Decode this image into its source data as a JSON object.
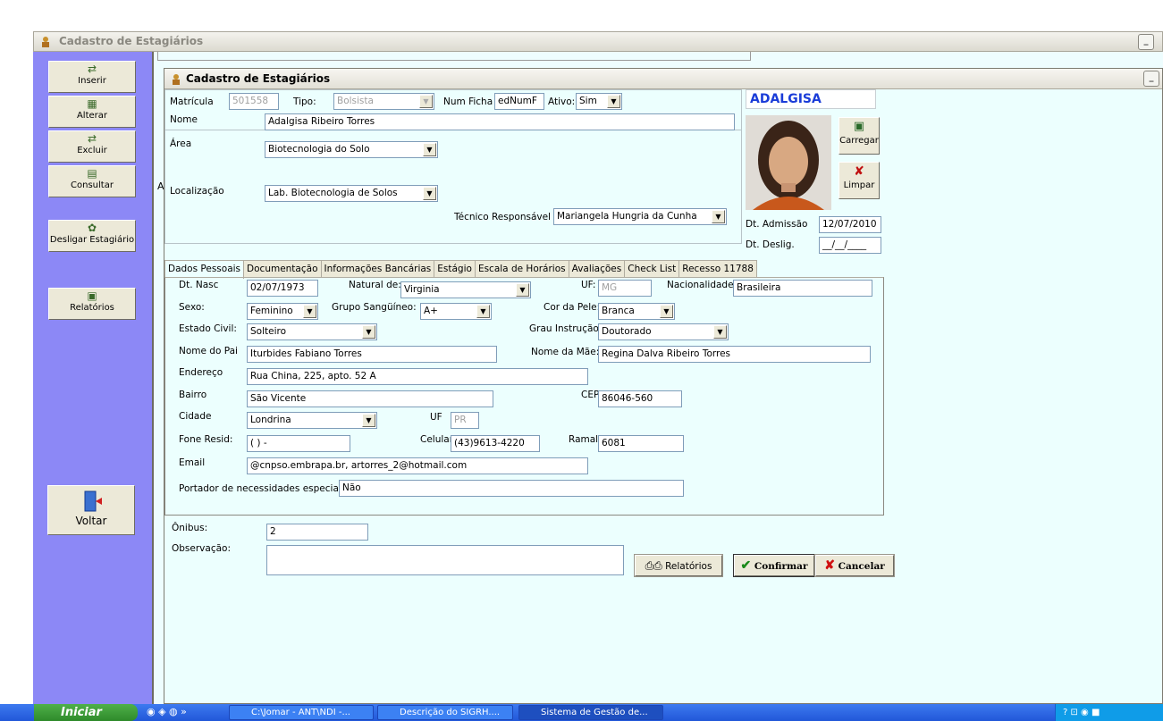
{
  "outer_window": {
    "title": "Cadastro de Estagiários"
  },
  "toolbar": {
    "insert_label": "Inserir",
    "alter_label": "Alterar",
    "delete_label": "Excluir",
    "query_label": "Consultar",
    "disconnect_label": "Desligar Estagiário",
    "reports_label": "Relatórios",
    "back_label": "Voltar"
  },
  "background_window": {
    "label_a": "A"
  },
  "inner_window": {
    "title": "Cadastro de Estagiários"
  },
  "header": {
    "matricula_label": "Matrícula",
    "matricula_value": "501558",
    "tipo_label": "Tipo:",
    "tipo_value": "Bolsista",
    "num_ficha_label": "Num Ficha",
    "num_ficha_value": "edNumF",
    "ativo_label": "Ativo:",
    "ativo_value": "Sim",
    "nome_label": "Nome",
    "nome_value": "Adalgisa Ribeiro Torres",
    "area_label": "Área",
    "area_value": "Biotecnologia do Solo",
    "localizacao_label": "Localização",
    "localizacao_value": "Lab. Biotecnologia de Solos",
    "tecnico_label": "Técnico Responsável",
    "tecnico_value": "Mariangela Hungria da Cunha"
  },
  "photo_panel": {
    "name_badge": "ADALGISA",
    "load_label": "Carregar",
    "clear_label": "Limpar",
    "admissao_label": "Dt. Admissão",
    "admissao_value": "12/07/2010",
    "deslig_label": "Dt. Deslig.",
    "deslig_value": "__/__/____"
  },
  "tabs": [
    "Dados Pessoais",
    "Documentação",
    "Informações Bancárias",
    "Estágio",
    "Escala de Horários",
    "Avaliações",
    "Check List",
    "Recesso 11788"
  ],
  "personal": {
    "nasc_label": "Dt. Nasc",
    "nasc_value": "02/07/1973",
    "natural_label": "Natural de:",
    "natural_value": "Virginia",
    "uf1_label": "UF:",
    "uf1_value": "MG",
    "nacionalidade_label": "Nacionalidade:",
    "nacionalidade_value": "Brasileira",
    "sexo_label": "Sexo:",
    "sexo_value": "Feminino",
    "sangue_label": "Grupo Sangüíneo:",
    "sangue_value": "A+",
    "pele_label": "Cor da Pele:",
    "pele_value": "Branca",
    "civil_label": "Estado Civil:",
    "civil_value": "Solteiro",
    "instrucao_label": "Grau Instrução:",
    "instrucao_value": "Doutorado",
    "pai_label": "Nome do Pai",
    "pai_value": "Iturbides Fabiano Torres",
    "mae_label": "Nome da Mãe:",
    "mae_value": "Regina Dalva Ribeiro Torres",
    "endereco_label": "Endereço",
    "endereco_value": "Rua China, 225, apto. 52 A",
    "bairro_label": "Bairro",
    "bairro_value": "São Vicente",
    "cep_label": "CEP",
    "cep_value": "86046-560",
    "cidade_label": "Cidade",
    "cidade_value": "Londrina",
    "uf2_label": "UF",
    "uf2_value": "PR",
    "fone_label": "Fone Resid:",
    "fone_value": "(  )   -",
    "celular_label": "Celular:",
    "celular_value": "(43)9613-4220",
    "ramal_label": "Ramal:",
    "ramal_value": "6081",
    "email_label": "Email",
    "email_value": "@cnpso.embrapa.br, artorres_2@hotmail.com",
    "necessidades_label": "Portador de necessidades especiais",
    "necessidades_value": "Não"
  },
  "footer": {
    "onibus_label": "Ônibus:",
    "onibus_value": "2",
    "obs_label": "Observação:",
    "obs_value": "",
    "reports_label": "Relatórios",
    "confirm_label": "Confirmar",
    "cancel_label": "Cancelar"
  },
  "taskbar": {
    "start_label": "Iniciar",
    "item1": "C:\\Jomar - ANT\\NDI -...",
    "item2": "Descrição do SIGRH....",
    "item3": "Sistema de Gestão de..."
  }
}
